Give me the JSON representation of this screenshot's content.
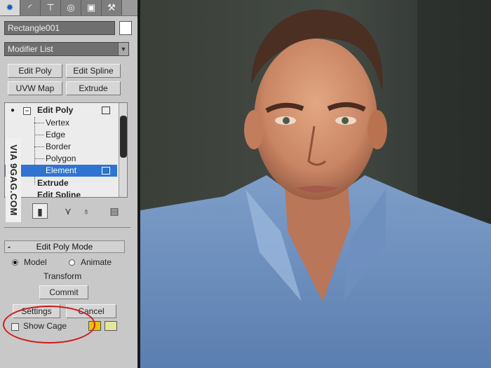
{
  "tabs": [
    {
      "name": "sun-icon",
      "glyph": "✹"
    },
    {
      "name": "curve-icon",
      "glyph": "◜"
    },
    {
      "name": "hierarchy-icon",
      "glyph": "⊤"
    },
    {
      "name": "motion-icon",
      "glyph": "◎"
    },
    {
      "name": "display-icon",
      "glyph": "▣"
    },
    {
      "name": "hammer-icon",
      "glyph": "⚒"
    }
  ],
  "object": {
    "name": "Rectangle001",
    "color": "#ffffff"
  },
  "modifier_list": {
    "label": "Modifier List"
  },
  "modifier_buttons": {
    "edit_poly": "Edit Poly",
    "edit_spline": "Edit Spline",
    "uvw_map": "UVW Map",
    "extrude": "Extrude"
  },
  "stack": {
    "edit_poly": "Edit Poly",
    "vertex": "Vertex",
    "edge": "Edge",
    "border": "Border",
    "polygon": "Polygon",
    "element": "Element",
    "extrude": "Extrude",
    "edit_spline": "Edit Spline",
    "selected": "Element"
  },
  "watermark": "VIA 9GAG.COM",
  "rollout": {
    "title": "Edit Poly Mode",
    "model": "Model",
    "animate": "Animate",
    "transform": "Transform",
    "commit": "Commit",
    "settings": "Settings",
    "cancel": "Cancel",
    "show_cage": "Show Cage",
    "cage_colors": [
      "#f2c000",
      "#e6e69a"
    ]
  },
  "colors": {
    "selection": "#2f74d0",
    "highlight_circle": "#d11a1a"
  }
}
